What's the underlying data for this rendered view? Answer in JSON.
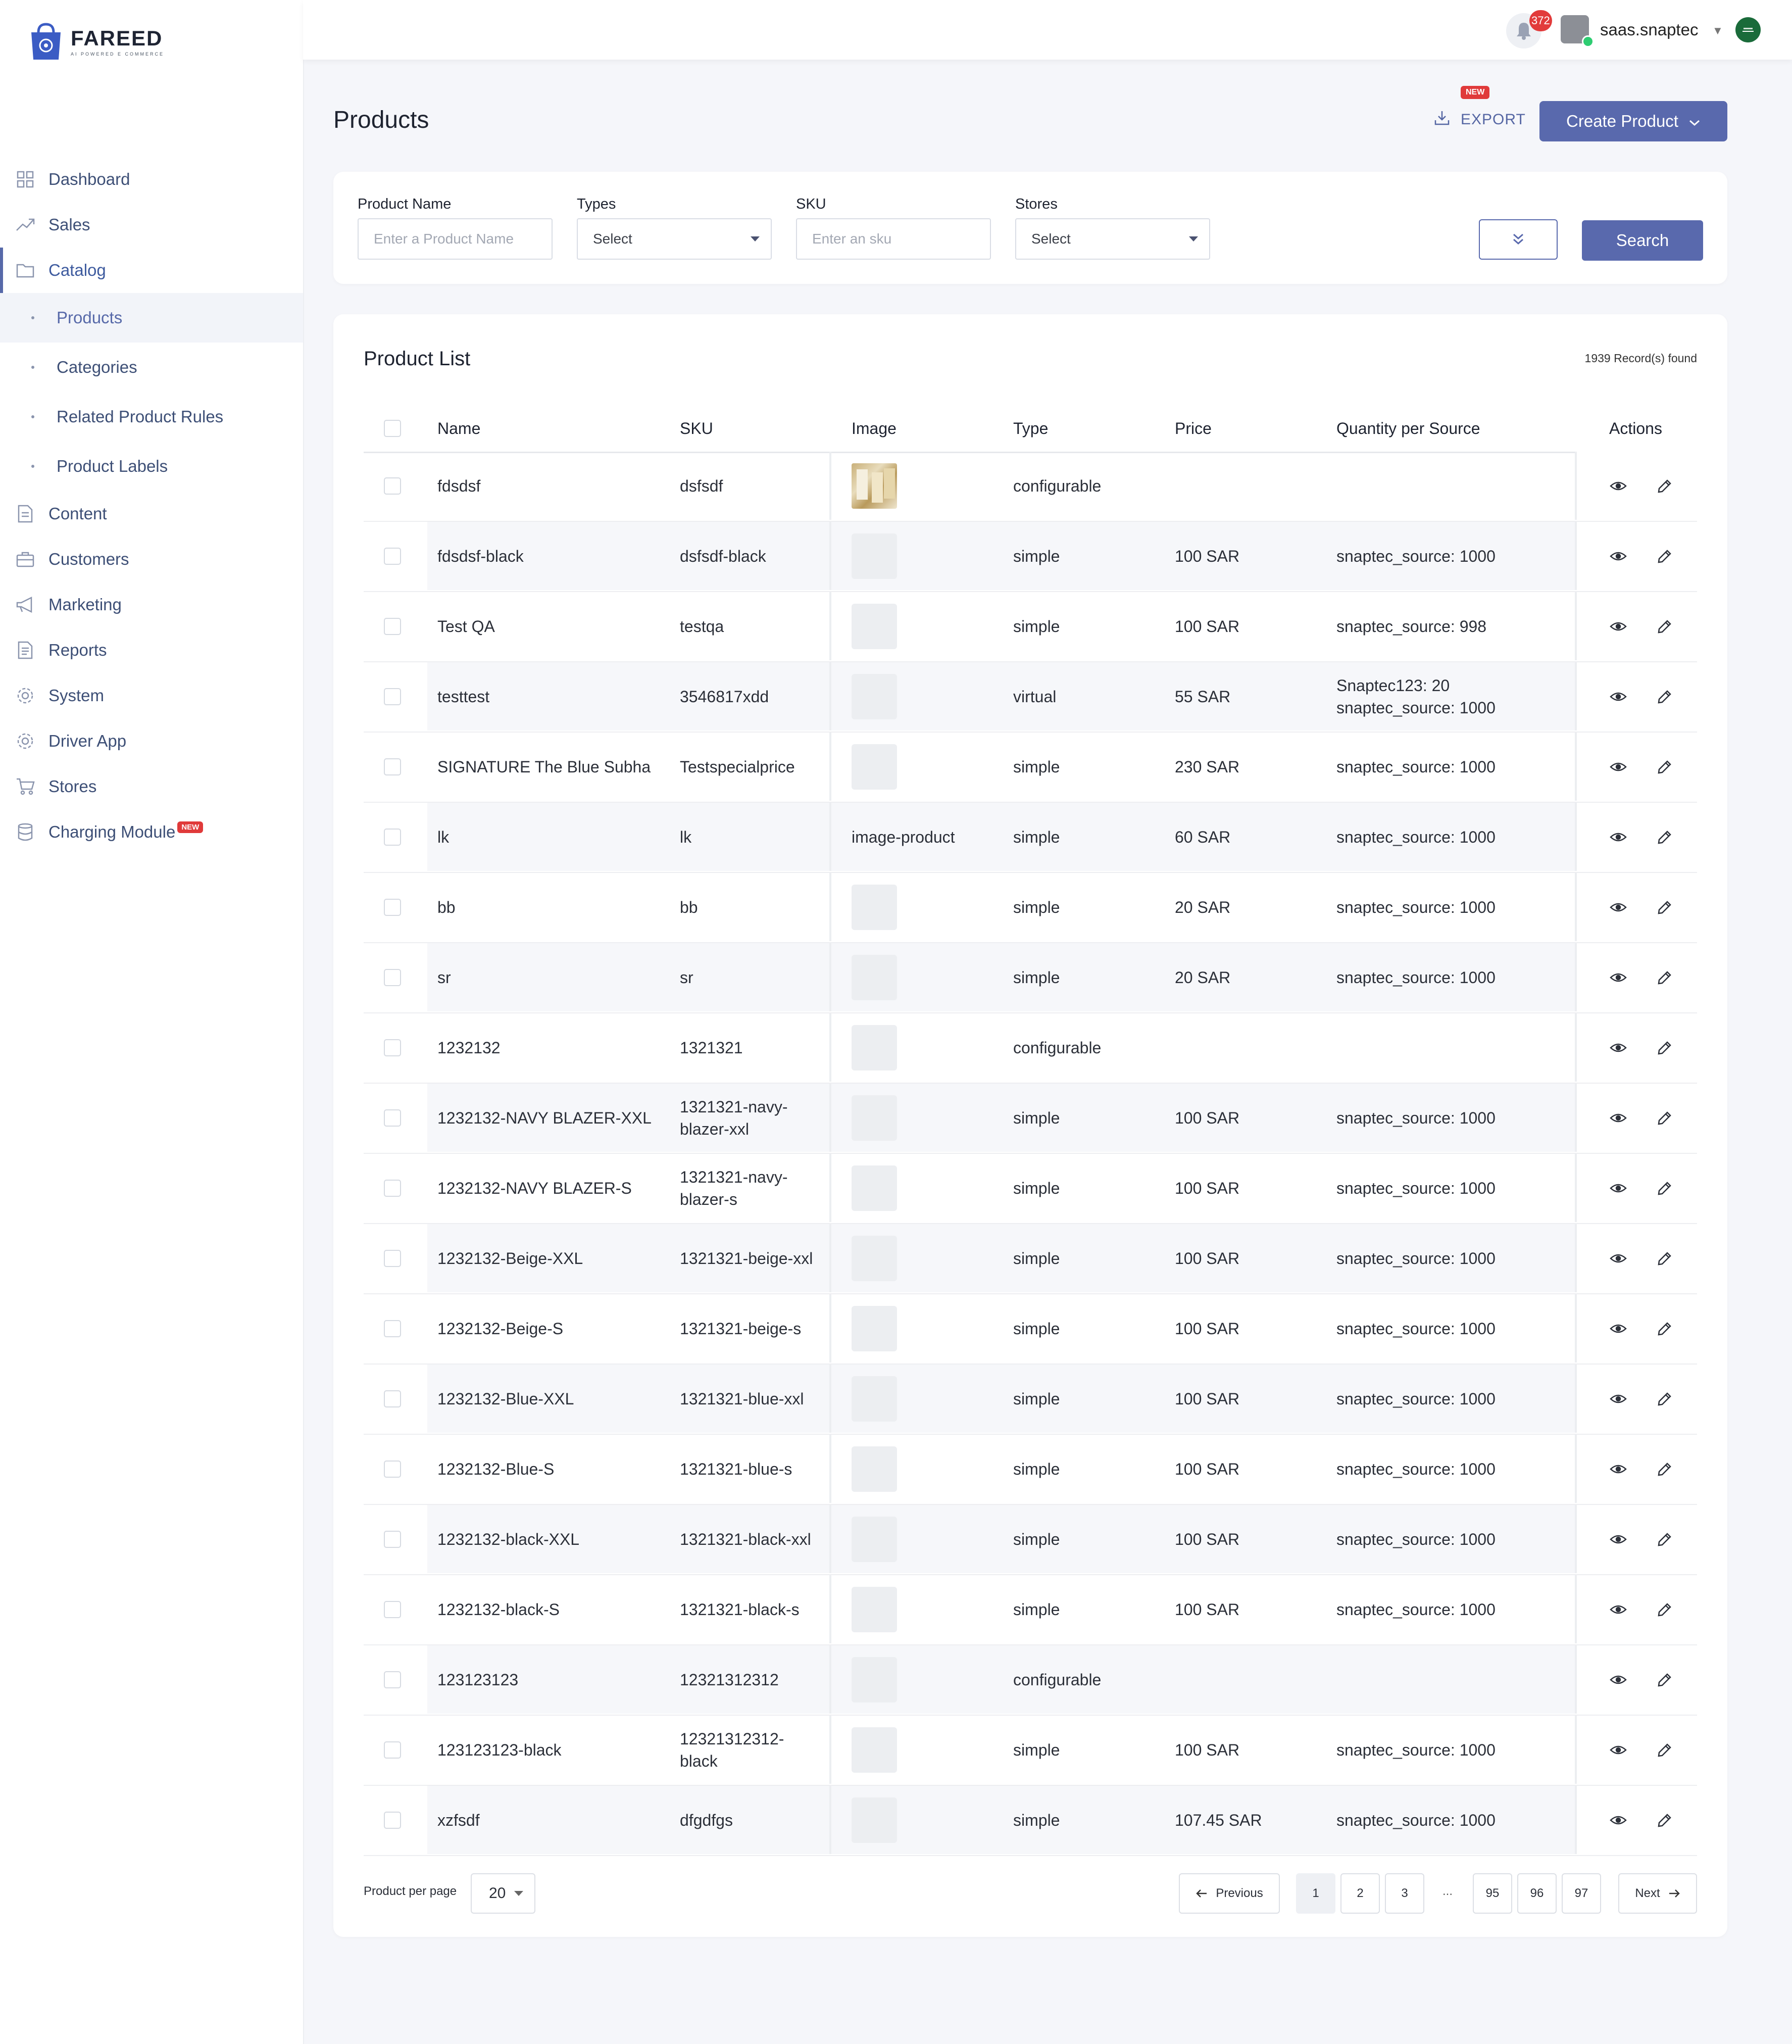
{
  "brand": {
    "name": "FAREED",
    "tagline": "AI POWERED E COMMERCE"
  },
  "sidebar": {
    "items": [
      {
        "label": "Dashboard",
        "icon": "grid-icon"
      },
      {
        "label": "Sales",
        "icon": "trending-up-icon"
      },
      {
        "label": "Catalog",
        "icon": "folder-icon"
      }
    ],
    "catalog_children": [
      {
        "label": "Products"
      },
      {
        "label": "Categories"
      },
      {
        "label": "Related Product Rules"
      },
      {
        "label": "Product Labels"
      }
    ],
    "items_after": [
      {
        "label": "Content",
        "icon": "document-icon"
      },
      {
        "label": "Customers",
        "icon": "briefcase-icon"
      },
      {
        "label": "Marketing",
        "icon": "megaphone-icon"
      },
      {
        "label": "Reports",
        "icon": "report-icon"
      },
      {
        "label": "System",
        "icon": "gear-icon"
      },
      {
        "label": "Driver App",
        "icon": "gear-icon"
      },
      {
        "label": "Stores",
        "icon": "cart-icon"
      },
      {
        "label": "Charging Module",
        "icon": "database-icon",
        "badge": "NEW"
      }
    ]
  },
  "topbar": {
    "notification_count": "372",
    "username": "saas.snaptec"
  },
  "header": {
    "title": "Products",
    "export_label": "EXPORT",
    "export_badge": "NEW",
    "create_label": "Create Product"
  },
  "filters": {
    "product_name": {
      "label": "Product Name",
      "placeholder": "Enter a Product Name"
    },
    "types": {
      "label": "Types",
      "value": "Select"
    },
    "sku": {
      "label": "SKU",
      "placeholder": "Enter an sku"
    },
    "stores": {
      "label": "Stores",
      "value": "Select"
    },
    "search_label": "Search"
  },
  "list": {
    "title": "Product List",
    "records": "1939 Record(s) found",
    "columns": [
      "Name",
      "SKU",
      "Image",
      "Type",
      "Price",
      "Quantity per Source",
      "Actions"
    ],
    "rows": [
      {
        "name": "fdsdsf",
        "sku": "dsfsdf",
        "image": "photo",
        "type": "configurable",
        "price": "",
        "qty": ""
      },
      {
        "name": "fdsdsf-black",
        "sku": "dsfsdf-black",
        "image": "blank",
        "type": "simple",
        "price": "100 SAR",
        "qty": "snaptec_source: 1000"
      },
      {
        "name": "Test QA",
        "sku": "testqa",
        "image": "blank",
        "type": "simple",
        "price": "100 SAR",
        "qty": "snaptec_source: 998"
      },
      {
        "name": "testtest",
        "sku": "3546817xdd",
        "image": "blank",
        "type": "virtual",
        "price": "55 SAR",
        "qty": "Snaptec123: 20\nsnaptec_source: 1000"
      },
      {
        "name": "SIGNATURE The Blue Subha",
        "sku": "Testspecialprice",
        "image": "blank",
        "type": "simple",
        "price": "230 SAR",
        "qty": "snaptec_source: 1000"
      },
      {
        "name": "lk",
        "sku": "lk",
        "image": "alt",
        "image_alt": "image-product",
        "type": "simple",
        "price": "60 SAR",
        "qty": "snaptec_source: 1000"
      },
      {
        "name": "bb",
        "sku": "bb",
        "image": "blank",
        "type": "simple",
        "price": "20 SAR",
        "qty": "snaptec_source: 1000"
      },
      {
        "name": "sr",
        "sku": "sr",
        "image": "blank",
        "type": "simple",
        "price": "20 SAR",
        "qty": "snaptec_source: 1000"
      },
      {
        "name": "1232132",
        "sku": "1321321",
        "image": "blank",
        "type": "configurable",
        "price": "",
        "qty": ""
      },
      {
        "name": "1232132-NAVY BLAZER-XXL",
        "sku": "1321321-navy-\nblazer-xxl",
        "image": "blank",
        "type": "simple",
        "price": "100 SAR",
        "qty": "snaptec_source: 1000"
      },
      {
        "name": "1232132-NAVY BLAZER-S",
        "sku": "1321321-navy-\nblazer-s",
        "image": "blank",
        "type": "simple",
        "price": "100 SAR",
        "qty": "snaptec_source: 1000"
      },
      {
        "name": "1232132-Beige-XXL",
        "sku": "1321321-beige-xxl",
        "image": "blank",
        "type": "simple",
        "price": "100 SAR",
        "qty": "snaptec_source: 1000"
      },
      {
        "name": "1232132-Beige-S",
        "sku": "1321321-beige-s",
        "image": "blank",
        "type": "simple",
        "price": "100 SAR",
        "qty": "snaptec_source: 1000"
      },
      {
        "name": "1232132-Blue-XXL",
        "sku": "1321321-blue-xxl",
        "image": "blank",
        "type": "simple",
        "price": "100 SAR",
        "qty": "snaptec_source: 1000"
      },
      {
        "name": "1232132-Blue-S",
        "sku": "1321321-blue-s",
        "image": "blank",
        "type": "simple",
        "price": "100 SAR",
        "qty": "snaptec_source: 1000"
      },
      {
        "name": "1232132-black-XXL",
        "sku": "1321321-black-xxl",
        "image": "blank",
        "type": "simple",
        "price": "100 SAR",
        "qty": "snaptec_source: 1000"
      },
      {
        "name": "1232132-black-S",
        "sku": "1321321-black-s",
        "image": "blank",
        "type": "simple",
        "price": "100 SAR",
        "qty": "snaptec_source: 1000"
      },
      {
        "name": "123123123",
        "sku": "12321312312",
        "image": "blank",
        "type": "configurable",
        "price": "",
        "qty": ""
      },
      {
        "name": "123123123-black",
        "sku": "12321312312-\nblack",
        "image": "blank",
        "type": "simple",
        "price": "100 SAR",
        "qty": "snaptec_source: 1000"
      },
      {
        "name": "xzfsdf",
        "sku": "dfgdfgs",
        "image": "blank",
        "type": "simple",
        "price": "107.45 SAR",
        "qty": "snaptec_source: 1000"
      }
    ]
  },
  "pagination": {
    "per_page_label": "Product per page",
    "per_page_value": "20",
    "previous": "Previous",
    "next": "Next",
    "pages": [
      "1",
      "2",
      "3"
    ],
    "ellipsis": "...",
    "last_pages": [
      "95",
      "96",
      "97"
    ],
    "current_page": "1"
  },
  "colors": {
    "accent": "#5969ad",
    "badge": "#e03a3a",
    "nav_text": "#3d4f76",
    "row_alt": "#f6f7fa"
  }
}
